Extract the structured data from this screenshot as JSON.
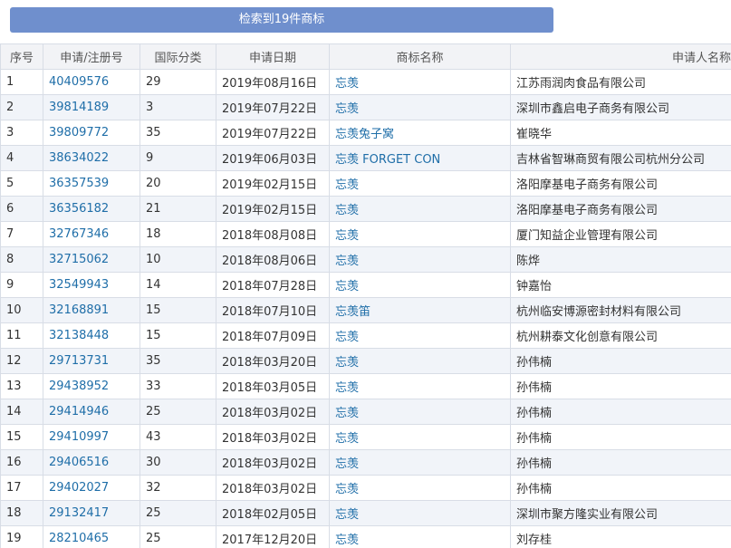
{
  "banner": {
    "label": "检索到19件商标"
  },
  "table": {
    "headers": [
      "序号",
      "申请/注册号",
      "国际分类",
      "申请日期",
      "商标名称",
      "申请人名称"
    ],
    "rows": [
      {
        "no": "1",
        "reg": "40409576",
        "cls": "29",
        "date": "2019年08月16日",
        "mark": "忘羡",
        "applicant": "江苏雨润肉食品有限公司"
      },
      {
        "no": "2",
        "reg": "39814189",
        "cls": "3",
        "date": "2019年07月22日",
        "mark": "忘羡",
        "applicant": "深圳市鑫启电子商务有限公司"
      },
      {
        "no": "3",
        "reg": "39809772",
        "cls": "35",
        "date": "2019年07月22日",
        "mark": "忘羡兔子窝",
        "applicant": "崔晓华"
      },
      {
        "no": "4",
        "reg": "38634022",
        "cls": "9",
        "date": "2019年06月03日",
        "mark": "忘羡 FORGET CON",
        "applicant": "吉林省智琳商贸有限公司杭州分公司"
      },
      {
        "no": "5",
        "reg": "36357539",
        "cls": "20",
        "date": "2019年02月15日",
        "mark": "忘羡",
        "applicant": "洛阳摩基电子商务有限公司"
      },
      {
        "no": "6",
        "reg": "36356182",
        "cls": "21",
        "date": "2019年02月15日",
        "mark": "忘羡",
        "applicant": "洛阳摩基电子商务有限公司"
      },
      {
        "no": "7",
        "reg": "32767346",
        "cls": "18",
        "date": "2018年08月08日",
        "mark": "忘羡",
        "applicant": "厦门知益企业管理有限公司"
      },
      {
        "no": "8",
        "reg": "32715062",
        "cls": "10",
        "date": "2018年08月06日",
        "mark": "忘羡",
        "applicant": "陈烨"
      },
      {
        "no": "9",
        "reg": "32549943",
        "cls": "14",
        "date": "2018年07月28日",
        "mark": "忘羡",
        "applicant": "钟嘉怡"
      },
      {
        "no": "10",
        "reg": "32168891",
        "cls": "15",
        "date": "2018年07月10日",
        "mark": "忘羡笛",
        "applicant": "杭州临安博源密封材料有限公司"
      },
      {
        "no": "11",
        "reg": "32138448",
        "cls": "15",
        "date": "2018年07月09日",
        "mark": "忘羡",
        "applicant": "杭州耕泰文化创意有限公司"
      },
      {
        "no": "12",
        "reg": "29713731",
        "cls": "35",
        "date": "2018年03月20日",
        "mark": "忘羡",
        "applicant": "孙伟楠"
      },
      {
        "no": "13",
        "reg": "29438952",
        "cls": "33",
        "date": "2018年03月05日",
        "mark": "忘羡",
        "applicant": "孙伟楠"
      },
      {
        "no": "14",
        "reg": "29414946",
        "cls": "25",
        "date": "2018年03月02日",
        "mark": "忘羡",
        "applicant": "孙伟楠"
      },
      {
        "no": "15",
        "reg": "29410997",
        "cls": "43",
        "date": "2018年03月02日",
        "mark": "忘羡",
        "applicant": "孙伟楠"
      },
      {
        "no": "16",
        "reg": "29406516",
        "cls": "30",
        "date": "2018年03月02日",
        "mark": "忘羡",
        "applicant": "孙伟楠"
      },
      {
        "no": "17",
        "reg": "29402027",
        "cls": "32",
        "date": "2018年03月02日",
        "mark": "忘羡",
        "applicant": "孙伟楠"
      },
      {
        "no": "18",
        "reg": "29132417",
        "cls": "25",
        "date": "2018年02月05日",
        "mark": "忘羡",
        "applicant": "深圳市聚方隆实业有限公司"
      },
      {
        "no": "19",
        "reg": "28210465",
        "cls": "25",
        "date": "2017年12月20日",
        "mark": "忘羡",
        "applicant": "刘存桂"
      }
    ]
  }
}
